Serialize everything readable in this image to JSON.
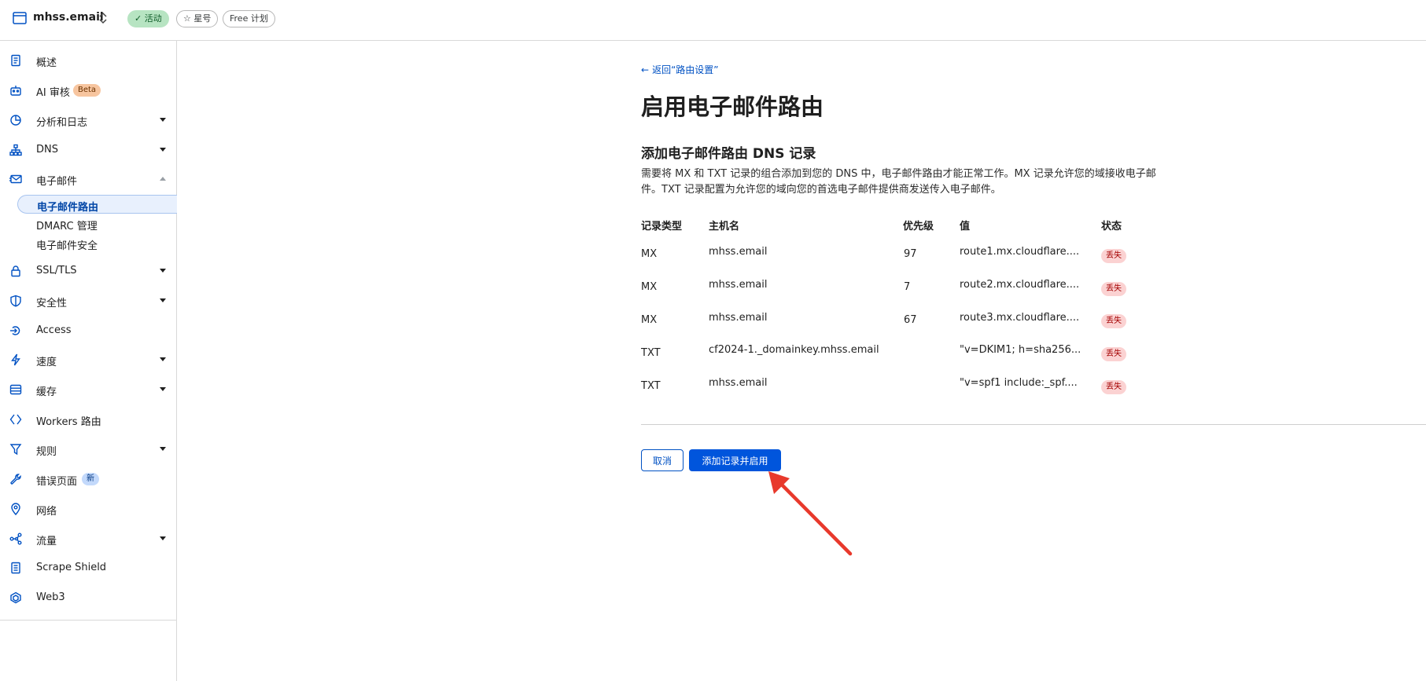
{
  "header": {
    "site_name": "mhss.email",
    "badges": {
      "active": "✓ 活动",
      "star": "☆ 星号",
      "plan": "Free 计划"
    }
  },
  "sidebar": {
    "items": [
      {
        "label": "概述",
        "icon": "document-icon"
      },
      {
        "label": "AI 审核",
        "icon": "robot-icon",
        "tag": "Beta"
      },
      {
        "label": "分析和日志",
        "icon": "pie-chart-icon",
        "expandable": true
      },
      {
        "label": "DNS",
        "icon": "network-icon",
        "expandable": true
      },
      {
        "label": "电子邮件",
        "icon": "mail-icon",
        "expanded": true
      },
      {
        "label": "SSL/TLS",
        "icon": "lock-icon",
        "expandable": true
      },
      {
        "label": "安全性",
        "icon": "shield-icon",
        "expandable": true
      },
      {
        "label": "Access",
        "icon": "access-icon"
      },
      {
        "label": "速度",
        "icon": "lightning-icon",
        "expandable": true
      },
      {
        "label": "缓存",
        "icon": "storage-icon",
        "expandable": true
      },
      {
        "label": "Workers 路由",
        "icon": "workers-icon"
      },
      {
        "label": "规则",
        "icon": "rules-icon",
        "expandable": true
      },
      {
        "label": "错误页面",
        "icon": "wrench-icon",
        "tag": "新"
      },
      {
        "label": "网络",
        "icon": "location-pin-icon"
      },
      {
        "label": "流量",
        "icon": "traffic-icon",
        "expandable": true
      },
      {
        "label": "Scrape Shield",
        "icon": "scrape-shield-icon"
      },
      {
        "label": "Web3",
        "icon": "web3-icon"
      }
    ],
    "email_sub": [
      {
        "label": "电子邮件路由",
        "active": true
      },
      {
        "label": "DMARC 管理"
      },
      {
        "label": "电子邮件安全"
      }
    ]
  },
  "main": {
    "back_link": "返回“路由设置”",
    "title": "启用电子邮件路由",
    "section_title": "添加电子邮件路由 DNS 记录",
    "description": "需要将 MX 和 TXT 记录的组合添加到您的 DNS 中，电子邮件路由才能正常工作。MX 记录允许您的域接收电子邮件。TXT 记录配置为允许您的域向您的首选电子邮件提供商发送传入电子邮件。",
    "table": {
      "headers": [
        "记录类型",
        "主机名",
        "优先级",
        "值",
        "状态"
      ],
      "rows": [
        {
          "type": "MX",
          "host": "mhss.email",
          "priority": "97",
          "value": "route1.mx.cloudflare....",
          "status": "丢失"
        },
        {
          "type": "MX",
          "host": "mhss.email",
          "priority": "7",
          "value": "route2.mx.cloudflare....",
          "status": "丢失"
        },
        {
          "type": "MX",
          "host": "mhss.email",
          "priority": "67",
          "value": "route3.mx.cloudflare....",
          "status": "丢失"
        },
        {
          "type": "TXT",
          "host": "cf2024-1._domainkey.mhss.email",
          "priority": "",
          "value": "\"v=DKIM1; h=sha256...",
          "status": "丢失"
        },
        {
          "type": "TXT",
          "host": "mhss.email",
          "priority": "",
          "value": "\"v=spf1 include:_spf....",
          "status": "丢失"
        }
      ]
    },
    "buttons": {
      "cancel": "取消",
      "submit": "添加记录并启用"
    }
  },
  "colors": {
    "accent": "#0051c3",
    "primary_button": "#0055dc",
    "status_missing_bg": "#fbd2d2",
    "annotation_arrow": "#e8392c"
  }
}
